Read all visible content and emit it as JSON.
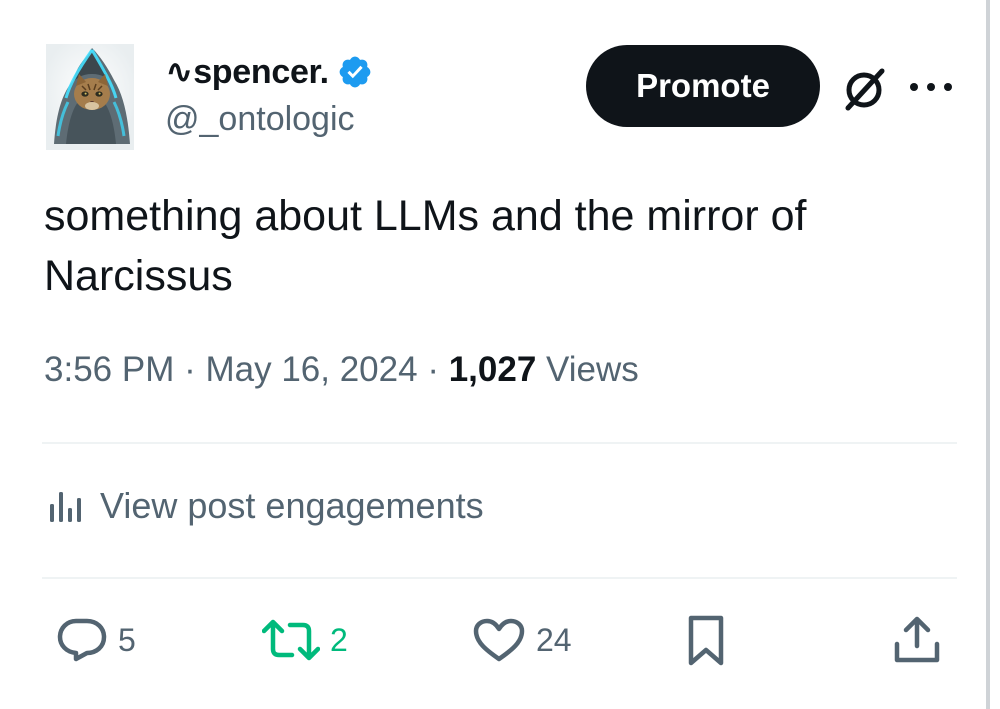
{
  "author": {
    "display_name": "∿spencer.",
    "handle": "@_ontologic",
    "verified": true
  },
  "header": {
    "promote_label": "Promote",
    "icons": [
      "avatar-cat-hood",
      "verified-badge-icon",
      "grok-icon",
      "more-icon"
    ]
  },
  "post": {
    "text": "something about LLMs and the mirror of Narcissus"
  },
  "meta": {
    "time": "3:56 PM",
    "separator": "·",
    "date": "May 16, 2024",
    "views_count": "1,027",
    "views_label": "Views"
  },
  "engagements": {
    "label": "View post engagements"
  },
  "actions": {
    "replies": "5",
    "reposts": "2",
    "likes": "24"
  },
  "colors": {
    "text_primary": "#0f1419",
    "text_secondary": "#536471",
    "verified_blue": "#1d9bf0",
    "repost_green": "#00ba7c",
    "promote_bg": "#0f1419",
    "divider": "#eff3f4"
  }
}
